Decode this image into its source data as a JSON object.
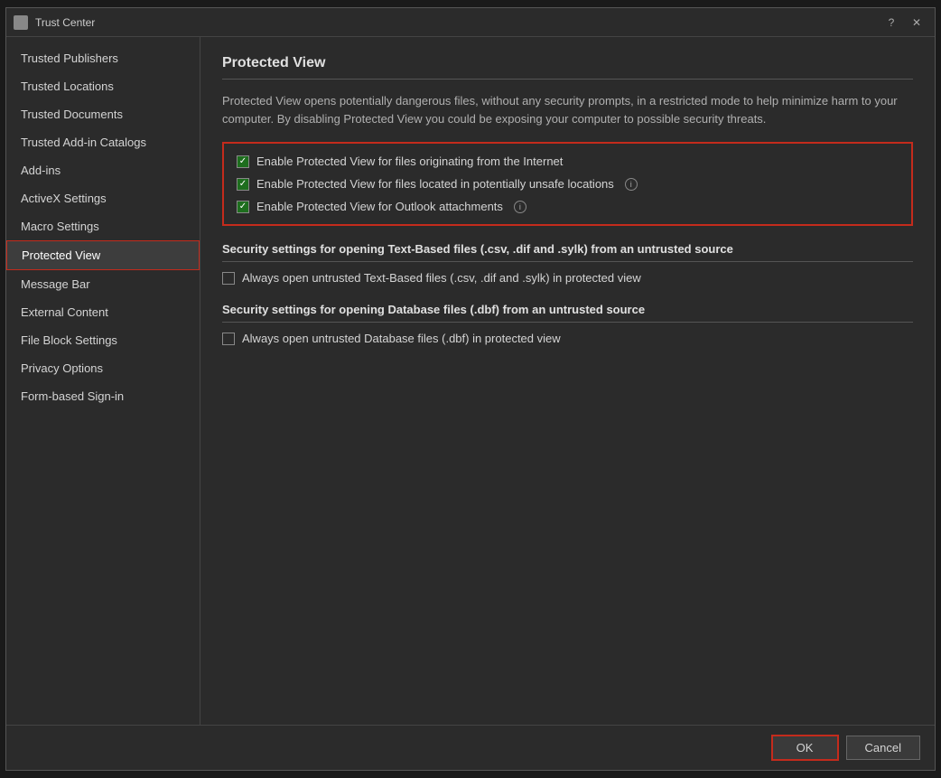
{
  "window": {
    "title": "Trust Center"
  },
  "sidebar": {
    "items": [
      {
        "id": "trusted-publishers",
        "label": "Trusted Publishers",
        "active": false
      },
      {
        "id": "trusted-locations",
        "label": "Trusted Locations",
        "active": false
      },
      {
        "id": "trusted-documents",
        "label": "Trusted Documents",
        "active": false
      },
      {
        "id": "trusted-add-in-catalogs",
        "label": "Trusted Add-in Catalogs",
        "active": false
      },
      {
        "id": "add-ins",
        "label": "Add-ins",
        "active": false
      },
      {
        "id": "activex-settings",
        "label": "ActiveX Settings",
        "active": false
      },
      {
        "id": "macro-settings",
        "label": "Macro Settings",
        "active": false
      },
      {
        "id": "protected-view",
        "label": "Protected View",
        "active": true
      },
      {
        "id": "message-bar",
        "label": "Message Bar",
        "active": false
      },
      {
        "id": "external-content",
        "label": "External Content",
        "active": false
      },
      {
        "id": "file-block-settings",
        "label": "File Block Settings",
        "active": false
      },
      {
        "id": "privacy-options",
        "label": "Privacy Options",
        "active": false
      },
      {
        "id": "form-based-sign-in",
        "label": "Form-based Sign-in",
        "active": false
      }
    ]
  },
  "main": {
    "section_title": "Protected View",
    "description": "Protected View opens potentially dangerous files, without any security prompts, in a restricted mode to help minimize harm to your computer. By disabling Protected View you could be exposing your computer to possible security threats.",
    "checkboxes": [
      {
        "id": "cb-internet",
        "checked": true,
        "label": "Enable Protected View for files originating from the Internet",
        "has_info": false
      },
      {
        "id": "cb-unsafe-locations",
        "checked": true,
        "label": "Enable Protected View for files located in potentially unsafe locations",
        "has_info": true
      },
      {
        "id": "cb-outlook",
        "checked": true,
        "label": "Enable Protected View for Outlook attachments",
        "has_info": true
      }
    ],
    "text_based_section": {
      "title": "Security settings for opening Text-Based files (.csv, .dif and .sylk) from an untrusted source",
      "checkbox_label": "Always open untrusted Text-Based files (.csv, .dif and .sylk) in protected view",
      "checked": false
    },
    "database_section": {
      "title": "Security settings for opening Database files (.dbf) from an untrusted source",
      "checkbox_label": "Always open untrusted Database files (.dbf) in protected view",
      "checked": false
    }
  },
  "footer": {
    "ok_label": "OK",
    "cancel_label": "Cancel"
  },
  "icons": {
    "checkmark": "✓",
    "close": "✕",
    "help": "?",
    "info": "i"
  }
}
